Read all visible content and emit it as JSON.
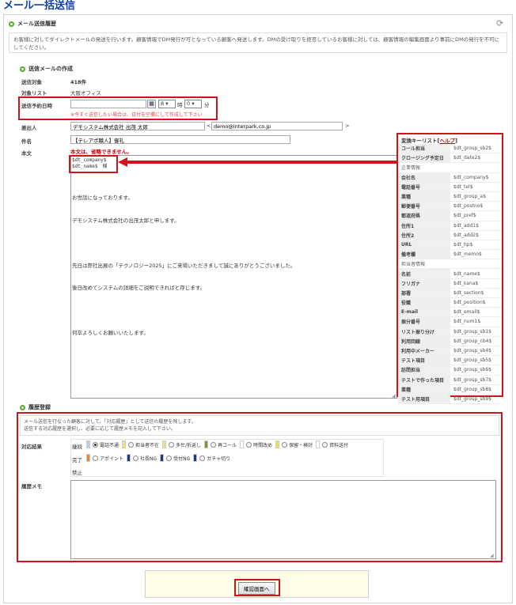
{
  "page_title": "メール一括送信",
  "history_section": {
    "title": "メール送信履歴",
    "intro": "お客様に対してダイレクトメールの発送を行います。顧客情報でDM発行が可となっている顧客へ発送します。DMの受け取りを拒否しているお客様に対しては、顧客情報の編集画面より事前にDMの発行を不可にしてください。"
  },
  "compose_section": {
    "title": "送信メールの作成",
    "target_label": "送信対象",
    "target_value": "418件",
    "list_label": "対象リスト",
    "list_value": "大阪オフィス",
    "schedule_label": "送信予約日時",
    "schedule_date_value": "",
    "schedule_hour": "8",
    "schedule_hour_unit": "時",
    "schedule_minute": "0",
    "schedule_minute_unit": "分",
    "schedule_note": "※今すぐ送信したい場合は、日付を空欄にして作成して下さい",
    "sender_label": "差出人",
    "sender_name": "デモシステム株式会社 出茂 太郎",
    "sender_email": "demo@interpark.co.jp",
    "subject_label": "件名",
    "subject_value": "【テレアポ職人】御礼",
    "body_label": "本文",
    "body_warning": "本文は、省略できません。",
    "body_var_lines": [
      "$dt_company$",
      "$dt_name$　様"
    ],
    "body_text_lines": [
      "お世話になっております。",
      "デモシステム株式会社の出茂太郎と申します。",
      "",
      "先日は弊社出展の「テクノロジー2025」にご来場いただきまして誠にありがとうございました。",
      "後日改めてシステムの詳細をご説明できればと存じます。",
      "",
      "何卒よろしくお願いいたします。"
    ]
  },
  "variables": {
    "head_label": "変換キーリスト",
    "help_link": "ヘルプ",
    "rows": [
      {
        "name": "コール担当",
        "value": "$dt_group_sb2$"
      },
      {
        "name": "クロージング予定日",
        "value": "$dt_date2$"
      },
      {
        "name": "企業情報",
        "value": "",
        "group": true
      },
      {
        "name": "会社名",
        "value": "$dt_company$"
      },
      {
        "name": "電話番号",
        "value": "$dt_tel$"
      },
      {
        "name": "業種",
        "value": "$dt_group_a$"
      },
      {
        "name": "郵便番号",
        "value": "$dt_postno$"
      },
      {
        "name": "都道府県",
        "value": "$dt_pref$"
      },
      {
        "name": "住所1",
        "value": "$dt_add1$"
      },
      {
        "name": "住所2",
        "value": "$dt_add2$"
      },
      {
        "name": "URL",
        "value": "$dt_hp$"
      },
      {
        "name": "備考欄",
        "value": "$dt_memo$"
      },
      {
        "name": "担当者情報",
        "value": "",
        "group": true
      },
      {
        "name": "名前",
        "value": "$dt_name$"
      },
      {
        "name": "フリガナ",
        "value": "$dt_kana$"
      },
      {
        "name": "部署",
        "value": "$dt_section$"
      },
      {
        "name": "役職",
        "value": "$dt_position$"
      },
      {
        "name": "E-mail",
        "value": "$dt_email$"
      },
      {
        "name": "振分番号",
        "value": "$dt_num1$"
      },
      {
        "name": "リスト振り分け",
        "value": "$dt_group_sb1$"
      },
      {
        "name": "利用回線",
        "value": "$dt_group_cb4$"
      },
      {
        "name": "利用中メーカー",
        "value": "$dt_group_sb4$"
      },
      {
        "name": "テスト項目",
        "value": "$dt_group_sb5$"
      },
      {
        "name": "訪問担当",
        "value": "$dt_group_sb6$"
      },
      {
        "name": "テストで作った項目",
        "value": "$dt_group_sb7$"
      },
      {
        "name": "業種",
        "value": "$dt_group_sb8$"
      },
      {
        "name": "テスト用項目",
        "value": "$dt_group_sb9$"
      }
    ]
  },
  "record_section": {
    "title": "履歴登録",
    "intro_line1": "メール送信を行なった顧客に対して、「対応履歴」として送信の履歴を残します。",
    "intro_line2": "送信する対応履歴を選択し、必要に応じて履歴メモを記入して下さい。",
    "result_label": "対応結果",
    "row1_label": "継続",
    "row2_label": "完了",
    "row3_label": "禁止",
    "row1_options": [
      {
        "label": "電話不通",
        "color": "#b7cdea",
        "checked": true
      },
      {
        "label": "担当者不在",
        "color": "#f1e27c",
        "checked": false
      },
      {
        "label": "多忙/折返し",
        "color": "#f1e27c",
        "checked": false
      },
      {
        "label": "再コール",
        "color": "#7a9a2e",
        "checked": false
      },
      {
        "label": "時間改め",
        "color": "#ffffff",
        "checked": false
      },
      {
        "label": "保留・検討",
        "color": "#e6e44a",
        "checked": false
      },
      {
        "label": "資料送付",
        "color": "#ffffff",
        "checked": false
      }
    ],
    "row2_options": [
      {
        "label": "アポイント",
        "color": "#e8852c",
        "checked": false
      },
      {
        "label": "社長NG",
        "color": "#1f3a7a",
        "checked": false
      },
      {
        "label": "受付NG",
        "color": "#1f3a7a",
        "checked": false
      },
      {
        "label": "ガチャ切り",
        "color": "#1f3a7a",
        "checked": false
      }
    ],
    "memo_label": "履歴メモ"
  },
  "confirm_button": "確認画面へ"
}
